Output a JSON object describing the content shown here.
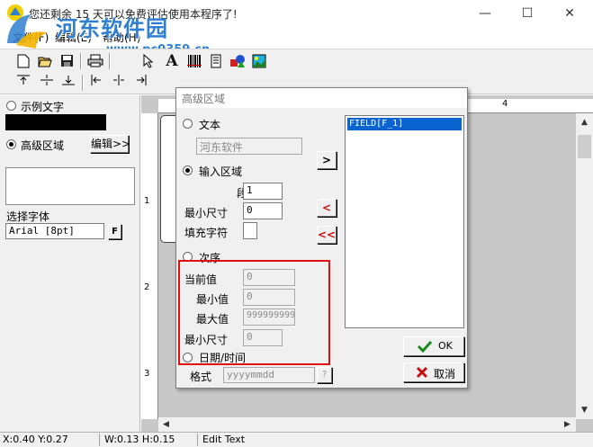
{
  "window": {
    "title": "您还剩余 15 天可以免费评估使用本程序了!",
    "controls": [
      "—",
      "☐",
      "✕"
    ]
  },
  "watermark": {
    "brand": "河东软件园",
    "url": "www.pc0359.cn"
  },
  "menu": {
    "items": [
      "文件(F)",
      "编辑(E)",
      "帮助(H)"
    ]
  },
  "toolbar1": {
    "icons": [
      "new-document-icon",
      "open-folder-icon",
      "save-disk-icon",
      "print-icon",
      "pointer-icon",
      "text-icon",
      "barcode-icon",
      "document-icon",
      "shapes-icon",
      "picture-icon"
    ]
  },
  "toolbar2": {
    "icons": [
      "align-top-icon",
      "align-middle-icon",
      "align-bottom-icon",
      "align-left-icon",
      "align-center-icon",
      "align-right-icon"
    ]
  },
  "left_panel": {
    "sample_text_label": "示例文字",
    "advanced_area_label": "高级区域",
    "edit_button": "编辑>>",
    "select_font_label": "选择字体",
    "font_value": "Arial [8pt]",
    "font_button": "F"
  },
  "rulers": {
    "top_label": "4",
    "left_labels": [
      "1",
      "2",
      "3"
    ]
  },
  "status": {
    "position": "X:0.40  Y:0.27",
    "size": "W:0.13  H:0.15",
    "mode": "Edit Text"
  },
  "dialog": {
    "title": "高级区域",
    "text_radio": "文本",
    "text_value": "河东软件",
    "input_area_radio": "输入区域",
    "paragraph_label": "段落 #",
    "paragraph_value": "1",
    "min_size_label": "最小尺寸",
    "min_size_value": "0",
    "fill_char_label": "填充字符",
    "fill_char_value": "",
    "sequence_radio": "次序",
    "current_value_label": "当前值",
    "current_value": "0",
    "min_value_label": "最小值",
    "min_value": "0",
    "max_value_label": "最大值",
    "max_value": "999999999",
    "seq_min_size_label": "最小尺寸",
    "seq_min_size_value": "0",
    "datetime_radio": "日期/时间",
    "format_label": "格式",
    "format_value": "yyyymmdd",
    "format_help": "?",
    "field_list": [
      "FIELD[F_1]"
    ],
    "add_button": ">",
    "remove_button": "<",
    "remove_all_button": "<<",
    "ok_button": "OK",
    "cancel_button": "取消"
  },
  "colors": {
    "highlight_frame": "#e01010",
    "list_selection": "#0a64d0",
    "ok_check": "#1a8a1a",
    "cancel_x": "#c01010",
    "arrow_red": "#c81010"
  }
}
